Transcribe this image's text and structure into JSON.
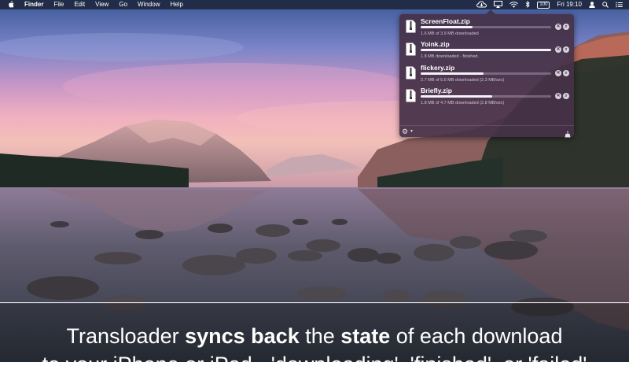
{
  "menubar": {
    "app_name": "Finder",
    "menus": [
      "File",
      "Edit",
      "View",
      "Go",
      "Window",
      "Help"
    ],
    "battery_label": "100",
    "clock": "Fri 19:10"
  },
  "downloads": [
    {
      "name": "ScreenFloat.zip",
      "progress": 0.4,
      "status": "1.6 MB of 3.9 MB downloaded"
    },
    {
      "name": "Yoink.zip",
      "progress": 1.0,
      "status": "1.8 MB downloaded - finished."
    },
    {
      "name": "flickery.zip",
      "progress": 0.48,
      "status": "2.7 MB of 5.6 MB downloaded (2.3 MB/sec)"
    },
    {
      "name": "Briefly.zip",
      "progress": 0.55,
      "status": "1.8 MB of 4.7 MB downloaded (2.8 MB/sec)"
    }
  ],
  "caption": {
    "line1": {
      "a": "Transloader ",
      "b": "syncs back",
      "c": " the ",
      "d": "state",
      "e": " of each download"
    },
    "line2": "to your iPhone or iPad - 'downloading', 'finished', or 'failed'"
  },
  "colors": {
    "popover_bg": "#46324a",
    "progress_fill": "#f4f2f6",
    "menubar_bg": "#1e263c"
  }
}
